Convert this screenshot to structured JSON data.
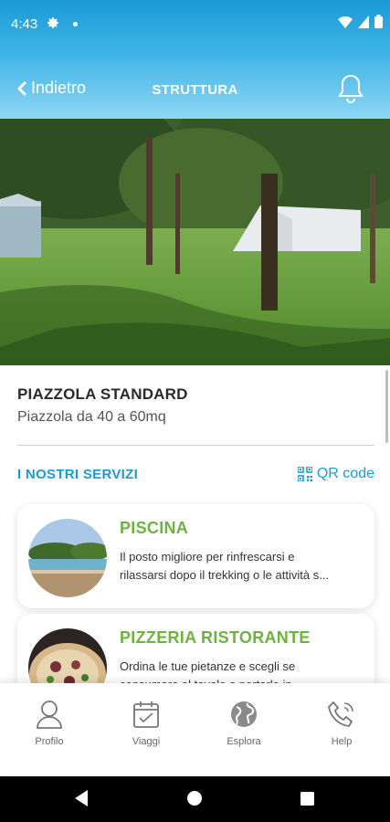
{
  "status": {
    "time": "4:43"
  },
  "nav": {
    "back_label": "Indietro",
    "title": "STRUTTURA"
  },
  "structure": {
    "title": "PIAZZOLA STANDARD",
    "subtitle": "Piazzola da 40 a 60mq"
  },
  "services": {
    "title": "I NOSTRI SERVIZI",
    "qr_label": "QR code",
    "items": [
      {
        "title": "PISCINA",
        "desc_line1": "Il posto migliore per rinfrescarsi e",
        "desc_line2": "rilassarsi dopo il trekking o le attività s..."
      },
      {
        "title": "PIZZERIA RISTORANTE",
        "desc_line1": "Ordina le tue pietanze e scegli se",
        "desc_line2": "consumare al tavolo o portarle in"
      }
    ]
  },
  "tabs": [
    {
      "label": "Profilo",
      "icon": "user-icon"
    },
    {
      "label": "Viaggi",
      "icon": "calendar-icon"
    },
    {
      "label": "Esplora",
      "icon": "globe-icon"
    },
    {
      "label": "Help",
      "icon": "phone-icon"
    }
  ],
  "colors": {
    "primary": "#1b9ad6",
    "accent_green": "#6db33f"
  }
}
